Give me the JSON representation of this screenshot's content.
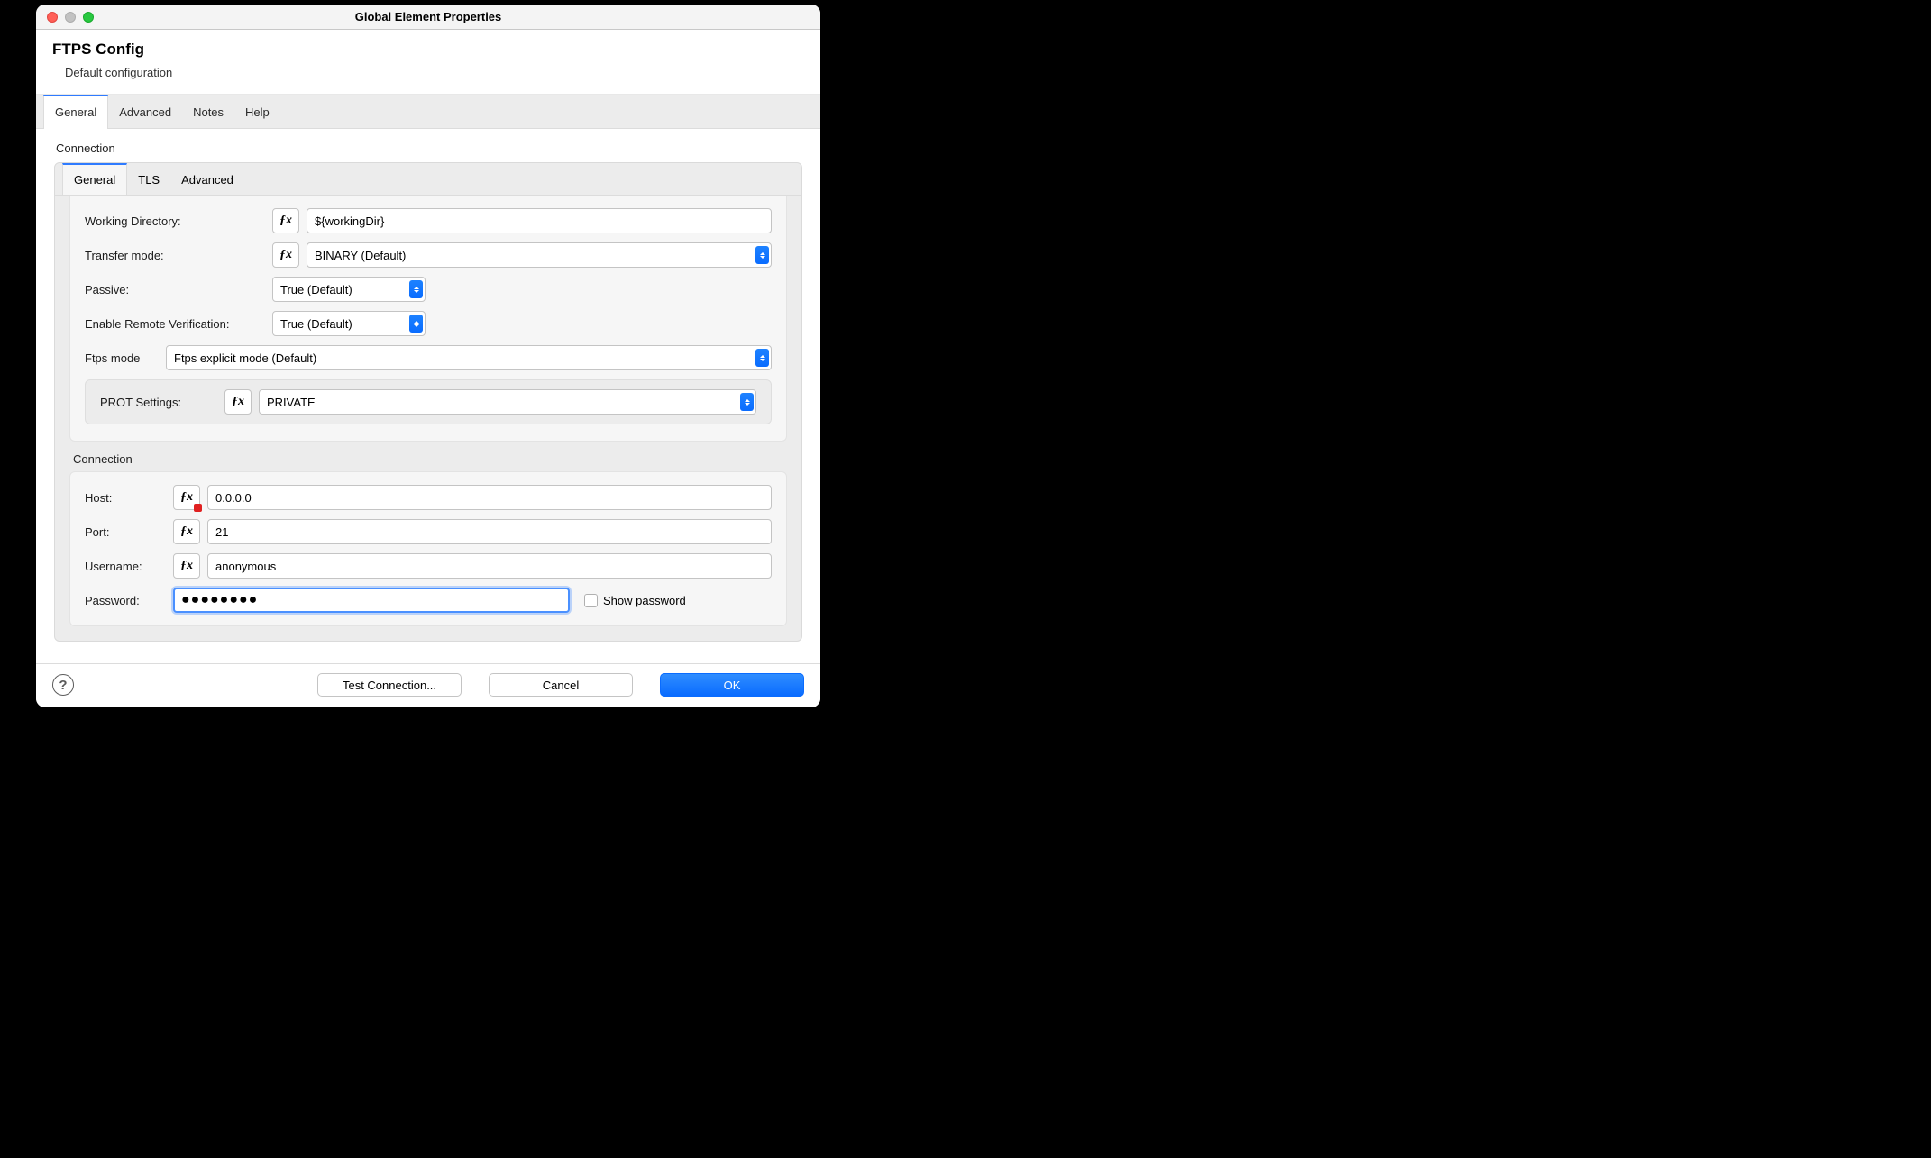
{
  "window": {
    "title": "Global Element Properties"
  },
  "header": {
    "title": "FTPS Config",
    "subtitle": "Default configuration"
  },
  "outer_tabs": {
    "general": "General",
    "advanced": "Advanced",
    "notes": "Notes",
    "help": "Help"
  },
  "section_top": {
    "label": "Connection"
  },
  "inner_tabs": {
    "general": "General",
    "tls": "TLS",
    "advanced": "Advanced"
  },
  "fields": {
    "working_dir": {
      "label": "Working Directory:",
      "value": "${workingDir}"
    },
    "transfer_mode": {
      "label": "Transfer mode:",
      "value": "BINARY (Default)"
    },
    "passive": {
      "label": "Passive:",
      "value": "True (Default)"
    },
    "remote_verify": {
      "label": "Enable Remote Verification:",
      "value": "True (Default)"
    },
    "ftps_mode": {
      "label": "Ftps mode",
      "value": "Ftps explicit mode (Default)"
    },
    "prot": {
      "label": "PROT Settings:",
      "value": "PRIVATE"
    }
  },
  "conn": {
    "label": "Connection",
    "host": {
      "label": "Host:",
      "value": "0.0.0.0"
    },
    "port": {
      "label": "Port:",
      "value": "21"
    },
    "username": {
      "label": "Username:",
      "value": "anonymous"
    },
    "password": {
      "label": "Password:",
      "value": "●●●●●●●●"
    },
    "show_password": "Show password"
  },
  "footer": {
    "test": "Test Connection...",
    "cancel": "Cancel",
    "ok": "OK"
  }
}
